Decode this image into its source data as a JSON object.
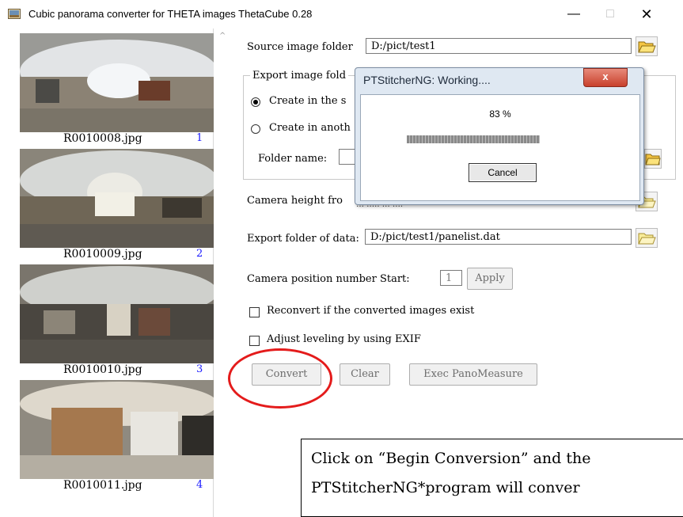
{
  "window": {
    "title": "Cubic panorama converter for THETA images ThetaCube 0.28",
    "minimize": "—",
    "maximize": "□",
    "close": "✕"
  },
  "thumbnails": [
    {
      "name": "R0010008.jpg",
      "number": "1"
    },
    {
      "name": "R0010009.jpg",
      "number": "2"
    },
    {
      "name": "R0010010.jpg",
      "number": "3"
    },
    {
      "name": "R0010011.jpg",
      "number": "4"
    }
  ],
  "form": {
    "source_label": "Source image folder",
    "source_value": "D:/pict/test1",
    "export_group_label": "Export image fold",
    "radio_same": "Create in the s",
    "radio_other": "Create in anoth",
    "folder_name_label": "Folder name:",
    "camera_height_label": "Camera height fro",
    "camera_height_tail": "… ….. … ….",
    "export_data_label": "Export folder of data:",
    "export_data_value": "D:/pict/test1/panelist.dat",
    "camera_pos_label": "Camera position number Start:",
    "camera_pos_value": "1",
    "apply": "Apply",
    "reconvert": "Reconvert if the converted images exist",
    "adjust": "Adjust leveling by using EXIF",
    "convert": "Convert",
    "clear": "Clear",
    "exec": "Exec PanoMeasure"
  },
  "dialog": {
    "title": "PTStitcherNG: Working....",
    "close": "x",
    "progress_text": "83 %",
    "progress": 0.83,
    "cancel": "Cancel"
  },
  "annotation": {
    "line1": "Click on “Begin Conversion” and the",
    "line2": "PTStitcherNG*program will conver",
    "circle_color": "#e41b1b"
  },
  "icons": {
    "folder": "folder-open-icon",
    "app": "app-icon"
  }
}
